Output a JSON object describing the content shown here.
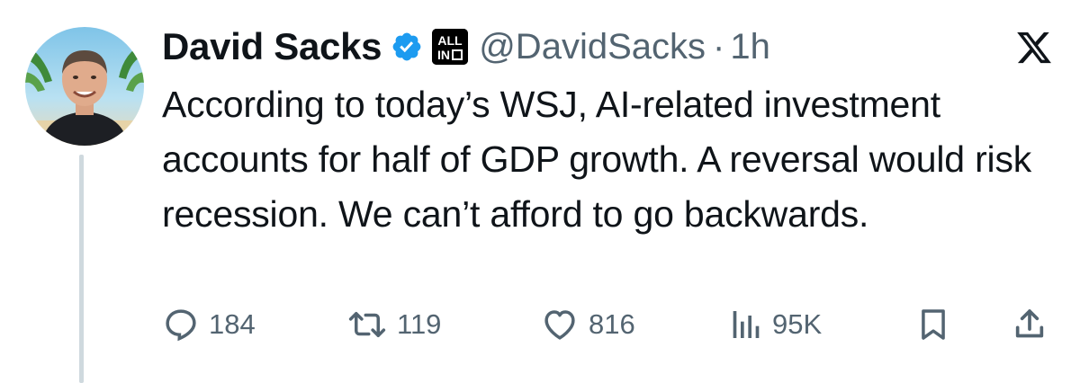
{
  "author": {
    "display_name": "David Sacks",
    "handle": "@DavidSacks",
    "separator": "·",
    "time_ago": "1h",
    "affiliate_badge_text": "ALL IN",
    "verified_icon": "verified-badge-icon",
    "avatar_icon": "avatar"
  },
  "platform_logo": "x-logo-icon",
  "tweet": {
    "text": "According to today’s WSJ, AI-related investment accounts for half of GDP growth. A reversal would risk recession. We can’t afford to go backwards."
  },
  "actions": {
    "replies": "184",
    "reposts": "119",
    "likes": "816",
    "views": "95K"
  },
  "colors": {
    "text_primary": "#0f1419",
    "text_secondary": "#536471",
    "verified_blue": "#1d9bf0",
    "thread_line": "#cfd9de"
  }
}
